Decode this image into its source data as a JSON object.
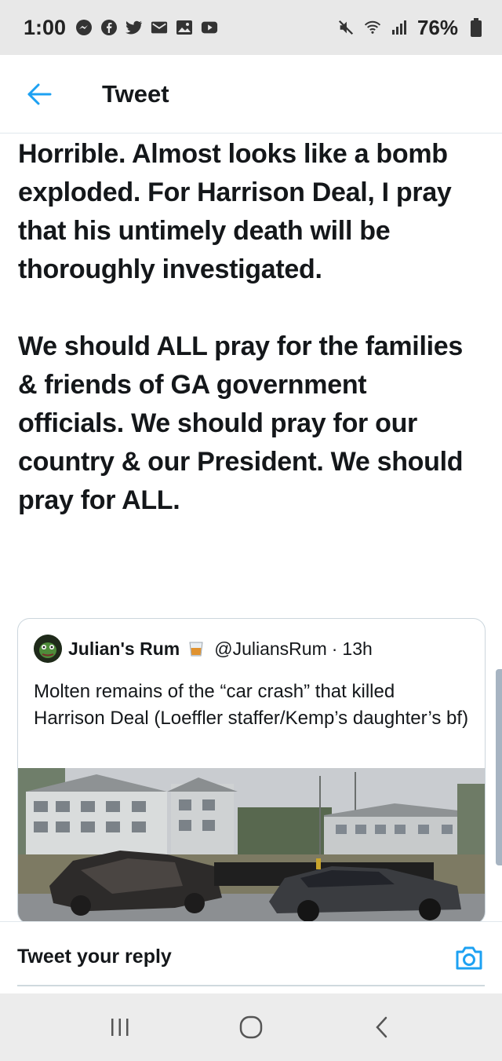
{
  "status_bar": {
    "time": "1:00",
    "battery_percent": "76%",
    "left_icons": [
      "messenger-icon",
      "facebook-icon",
      "twitter-icon",
      "gmail-icon",
      "gallery-icon",
      "youtube-icon"
    ],
    "right_icons": [
      "mute-icon",
      "wifi-icon",
      "signal-icon",
      "battery-icon"
    ]
  },
  "header": {
    "title": "Tweet",
    "accent_color": "#1da1f2"
  },
  "tweet": {
    "text": "Horrible. Almost looks like a bomb exploded. For Harrison Deal, I pray that his untimely death will be thoroughly investigated.\n\nWe should ALL pray for the families & friends of GA government officials. We should pray for our country & our President. We should pray for ALL."
  },
  "quoted_tweet": {
    "display_name": "Julian's Rum",
    "handle": "@JuliansRum",
    "separator": "·",
    "time_ago": "13h",
    "text": "Molten remains of the “car crash” that killed Harrison Deal (Loeffler staffer/Kemp’s daughter’s bf)"
  },
  "reply": {
    "placeholder": "Tweet your reply"
  },
  "navigation": {
    "buttons": [
      "recent-apps-icon",
      "home-icon",
      "back-icon"
    ]
  }
}
